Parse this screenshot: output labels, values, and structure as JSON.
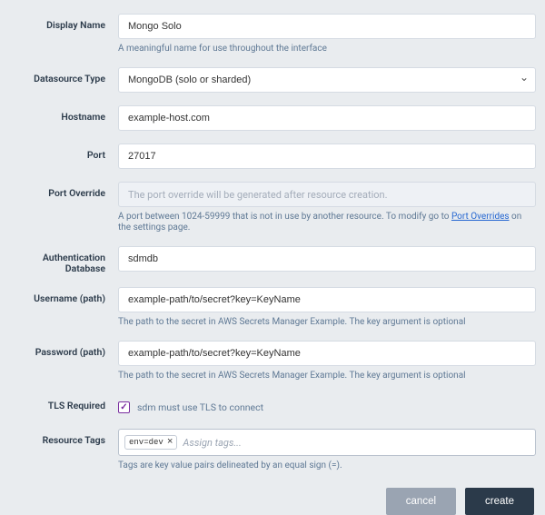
{
  "labels": {
    "displayName": "Display Name",
    "datasourceType": "Datasource Type",
    "hostname": "Hostname",
    "port": "Port",
    "portOverride": "Port Override",
    "authDb": "Authentication Database",
    "username": "Username (path)",
    "password": "Password (path)",
    "tls": "TLS Required",
    "tags": "Resource Tags"
  },
  "values": {
    "displayName": "Mongo Solo",
    "datasourceType": "MongoDB (solo or sharded)",
    "hostname": "example-host.com",
    "port": "27017",
    "portOverridePlaceholder": "The port override will be generated after resource creation.",
    "authDb": "sdmdb",
    "username": "example-path/to/secret?key=KeyName",
    "password": "example-path/to/secret?key=KeyName",
    "tlsChecked": true,
    "tlsLabel": "sdm must use TLS to connect",
    "tagChip": "env=dev",
    "tagPlaceholder": "Assign tags..."
  },
  "helpers": {
    "displayName": "A meaningful name for use throughout the interface",
    "portOverridePrefix": "A port between 1024-59999 that is not in use by another resource. To modify go to ",
    "portOverrideLink": "Port Overrides",
    "portOverrideSuffix": " on the settings page.",
    "secretHelper": "The path to the secret in AWS Secrets Manager Example. The key argument is optional",
    "tagsHelper": "Tags are key value pairs delineated by an equal sign (=)."
  },
  "buttons": {
    "cancel": "cancel",
    "create": "create"
  }
}
